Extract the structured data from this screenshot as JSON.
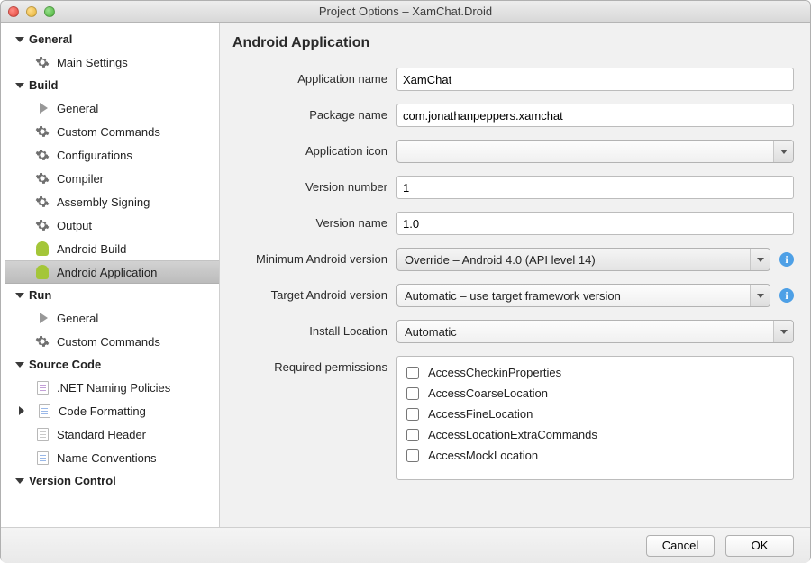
{
  "window": {
    "title": "Project Options – XamChat.Droid"
  },
  "sidebar": {
    "groups": [
      {
        "label": "General",
        "items": [
          "Main Settings"
        ]
      },
      {
        "label": "Build",
        "items": [
          "General",
          "Custom Commands",
          "Configurations",
          "Compiler",
          "Assembly Signing",
          "Output",
          "Android Build",
          "Android Application"
        ]
      },
      {
        "label": "Run",
        "items": [
          "General",
          "Custom Commands"
        ]
      },
      {
        "label": "Source Code",
        "items": [
          ".NET Naming Policies",
          "Code Formatting",
          "Standard Header",
          "Name Conventions"
        ]
      },
      {
        "label": "Version Control",
        "items": []
      }
    ],
    "selected": "Android Application"
  },
  "page": {
    "heading": "Android Application",
    "labels": {
      "app_name": "Application name",
      "package_name": "Package name",
      "app_icon": "Application icon",
      "version_number": "Version number",
      "version_name": "Version name",
      "min_android": "Minimum Android version",
      "target_android": "Target Android version",
      "install_location": "Install Location",
      "permissions": "Required permissions"
    },
    "values": {
      "app_name": "XamChat",
      "package_name": "com.jonathanpeppers.xamchat",
      "app_icon": "",
      "version_number": "1",
      "version_name": "1.0",
      "min_android": "Override – Android 4.0 (API level 14)",
      "target_android": "Automatic – use target framework version",
      "install_location": "Automatic"
    },
    "permissions": [
      "AccessCheckinProperties",
      "AccessCoarseLocation",
      "AccessFineLocation",
      "AccessLocationExtraCommands",
      "AccessMockLocation"
    ]
  },
  "footer": {
    "cancel": "Cancel",
    "ok": "OK"
  }
}
